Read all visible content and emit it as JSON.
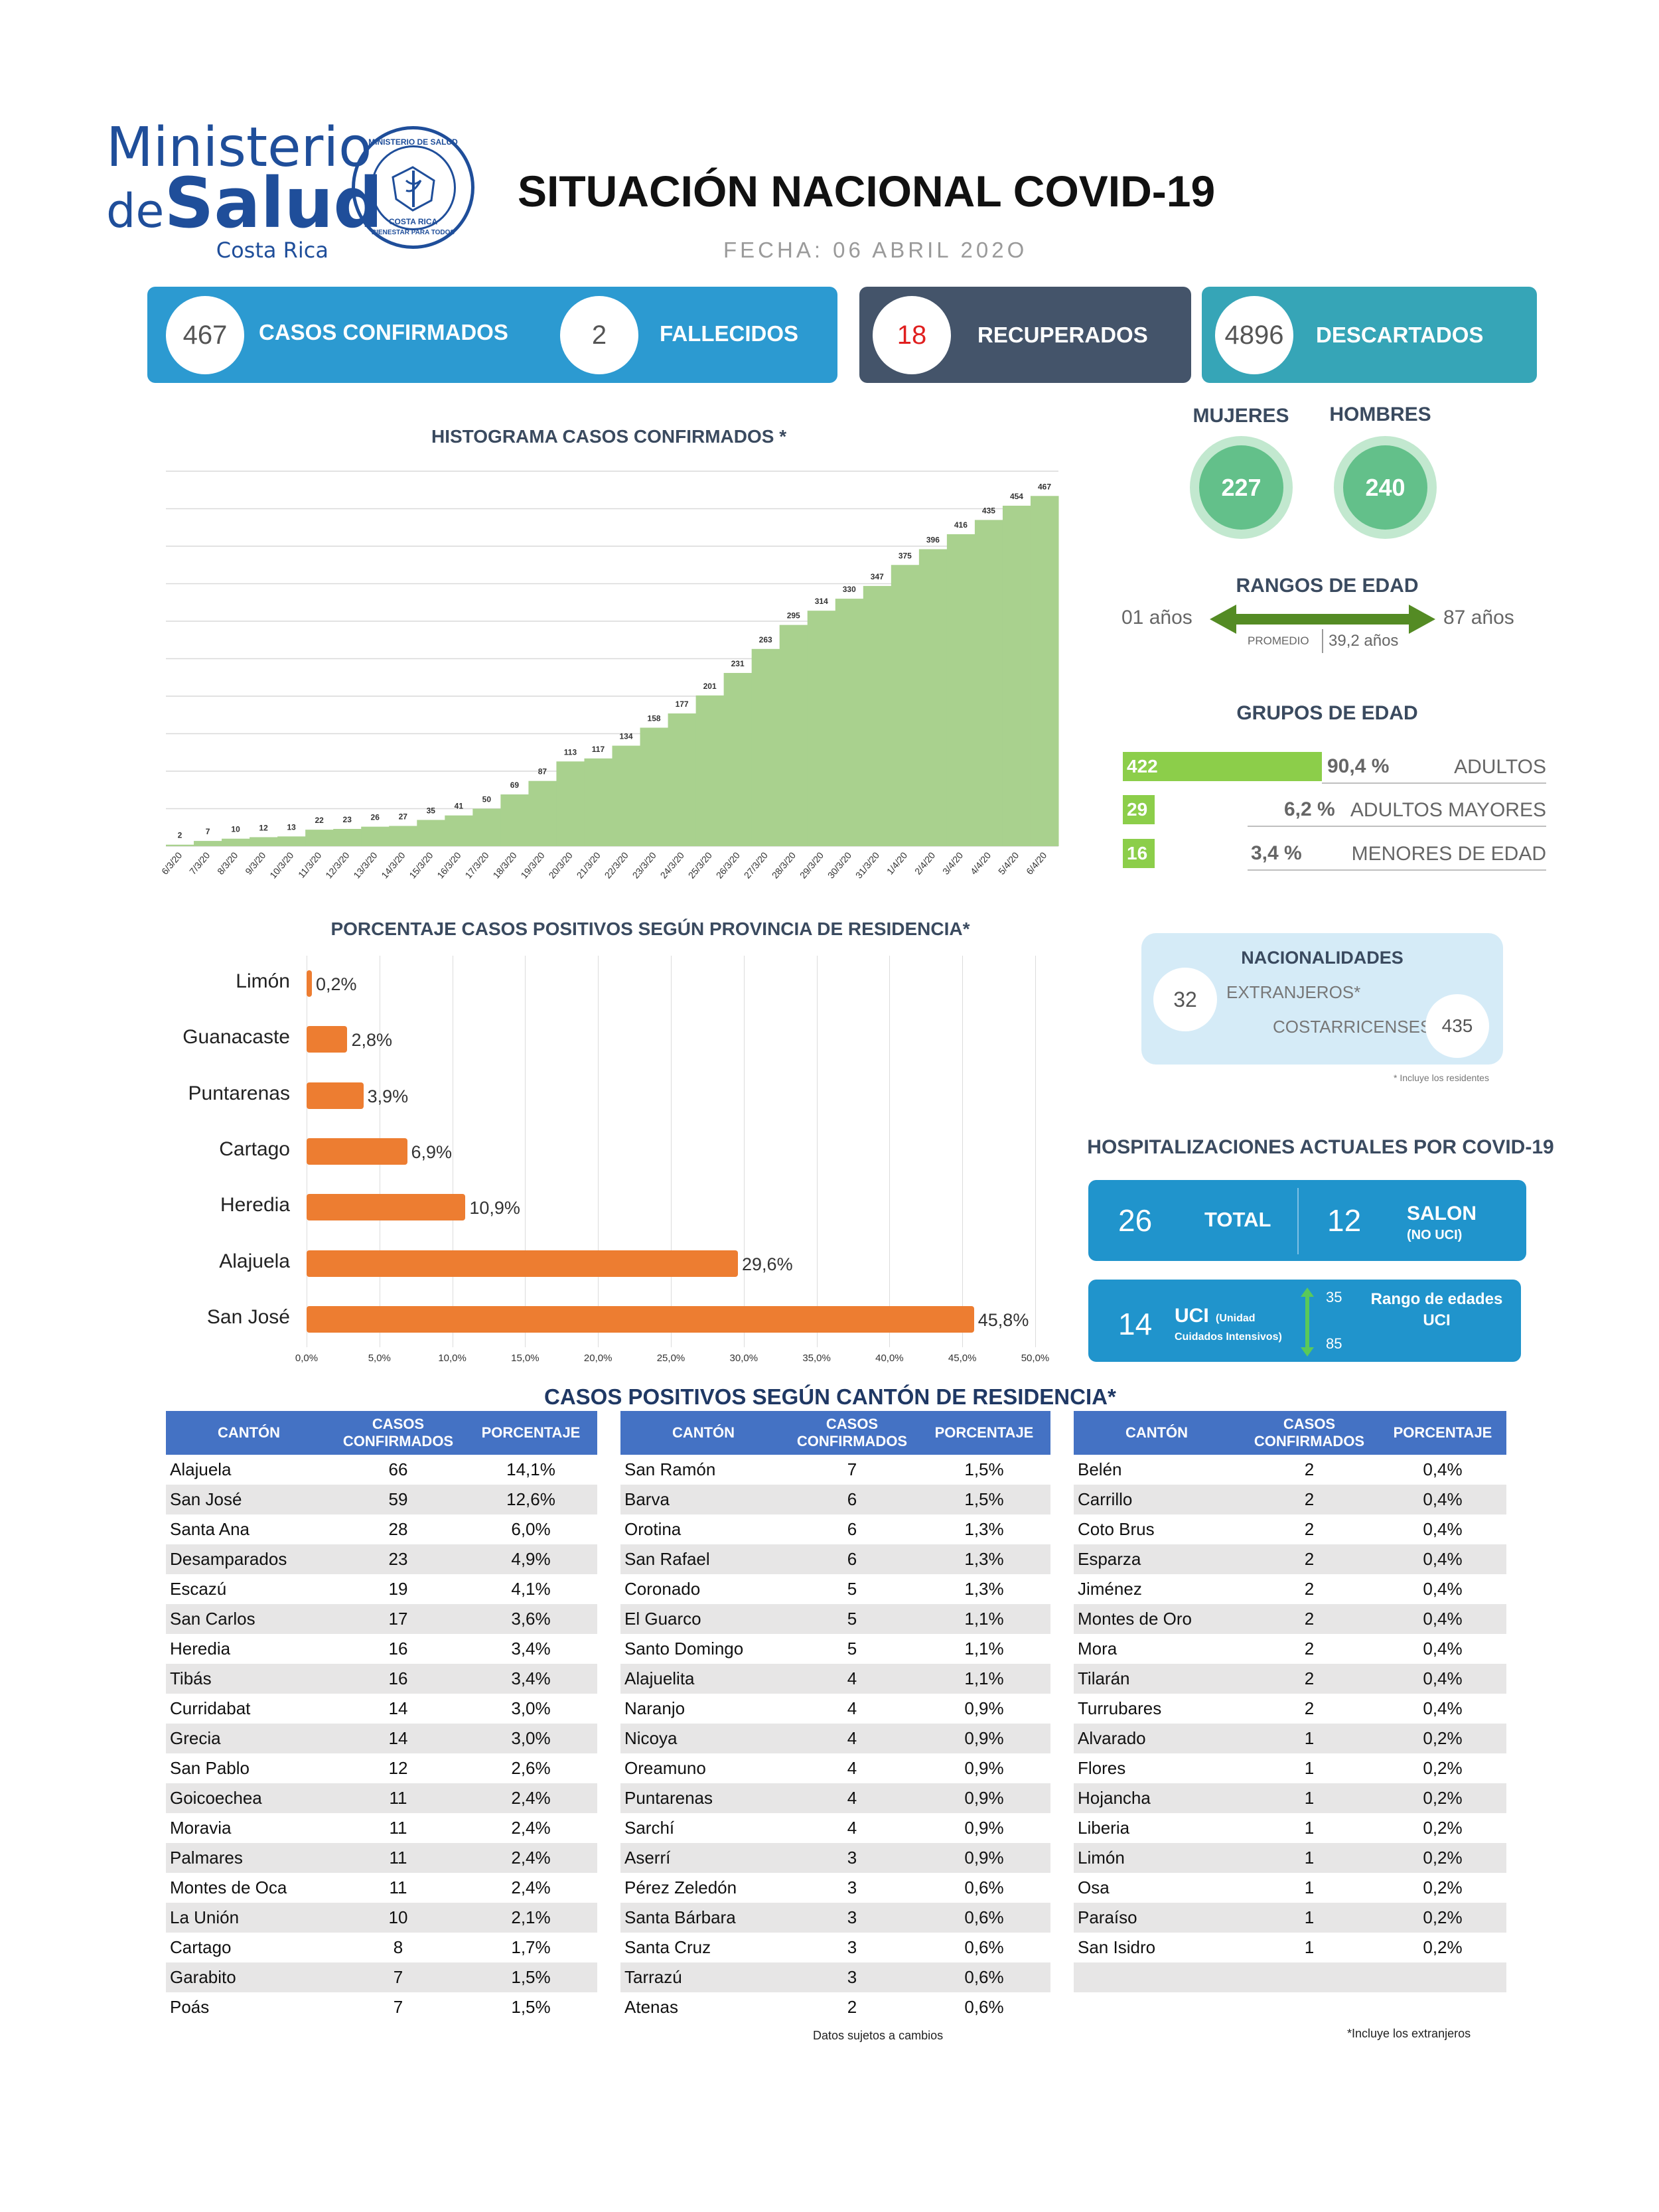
{
  "header": {
    "logo_line1": "Ministerio",
    "logo_de": "de",
    "logo_salud": "Salud",
    "logo_country": "Costa Rica",
    "seal_top": "MINISTERIO DE SALUD",
    "seal_mid": "COSTA RICA",
    "seal_bottom": "BIENESTAR PARA TODOS",
    "title": "SITUACIÓN NACIONAL COVID-19",
    "fecha": "FECHA: 06  ABRIL 202O"
  },
  "kpis": {
    "confirmados_value": "467",
    "confirmados_label": "CASOS CONFIRMADOS",
    "fallecidos_value": "2",
    "fallecidos_label": "FALLECIDOS",
    "recuperados_value": "18",
    "recuperados_label": "RECUPERADOS",
    "descartados_value": "4896",
    "descartados_label": "DESCARTADOS",
    "colors": {
      "blue": "#2c9ad1",
      "dark": "#44546a",
      "teal": "#36a5b7",
      "red": "#e01f1f"
    }
  },
  "histogram": {
    "title": "HISTOGRAMA CASOS CONFIRMADOS *"
  },
  "chart_data": [
    {
      "type": "area",
      "title": "HISTOGRAMA CASOS CONFIRMADOS *",
      "x": [
        "6/3/20",
        "7/3/20",
        "8/3/20",
        "9/3/20",
        "10/3/20",
        "11/3/20",
        "12/3/20",
        "13/3/20",
        "14/3/20",
        "15/3/20",
        "16/3/20",
        "17/3/20",
        "18/3/20",
        "19/3/20",
        "20/3/20",
        "21/3/20",
        "22/3/20",
        "23/3/20",
        "24/3/20",
        "25/3/20",
        "26/3/20",
        "27/3/20",
        "28/3/20",
        "29/3/20",
        "30/3/20",
        "31/3/20",
        "1/4/20",
        "2/4/20",
        "3/4/20",
        "4/4/20",
        "5/4/20",
        "6/4/20"
      ],
      "values": [
        2,
        7,
        10,
        12,
        13,
        22,
        23,
        26,
        27,
        35,
        41,
        50,
        69,
        87,
        113,
        117,
        134,
        158,
        177,
        201,
        231,
        263,
        295,
        314,
        330,
        347,
        375,
        396,
        416,
        435,
        454,
        467
      ],
      "ylim": [
        0,
        500
      ],
      "grid": true,
      "color": "#a9d18e"
    },
    {
      "type": "bar",
      "orientation": "horizontal",
      "title": "PORCENTAJE CASOS POSITIVOS SEGÚN PROVINCIA DE RESIDENCIA*",
      "categories": [
        "Limón",
        "Guanacaste",
        "Puntarenas",
        "Cartago",
        "Heredia",
        "Alajuela",
        "San José"
      ],
      "values": [
        0.2,
        2.8,
        3.9,
        6.9,
        10.9,
        29.6,
        45.8
      ],
      "value_labels": [
        "0,2%",
        "2,8%",
        "3,9%",
        "6,9%",
        "10,9%",
        "29,6%",
        "45,8%"
      ],
      "xticks": [
        "0,0%",
        "5,0%",
        "10,0%",
        "15,0%",
        "20,0%",
        "25,0%",
        "30,0%",
        "35,0%",
        "40,0%",
        "45,0%",
        "50,0%"
      ],
      "xlim": [
        0,
        50
      ],
      "color": "#ed7d31"
    }
  ],
  "provincias": {
    "title": "PORCENTAJE CASOS POSITIVOS SEGÚN PROVINCIA DE RESIDENCIA*"
  },
  "sexo": {
    "mujeres_label": "MUJERES",
    "mujeres_value": "227",
    "hombres_label": "HOMBRES",
    "hombres_value": "240"
  },
  "rangos": {
    "title": "RANGOS DE EDAD",
    "min": "01 años",
    "max": "87 años",
    "promedio_label": "PROMEDIO",
    "promedio_value": "39,2 años"
  },
  "grupos": {
    "title": "GRUPOS DE EDAD",
    "rows": [
      {
        "count": "422",
        "pct": "90,4 %",
        "label": "ADULTOS",
        "fraction": 0.904
      },
      {
        "count": "29",
        "pct": "6,2 %",
        "label": "ADULTOS MAYORES",
        "fraction": 0.062
      },
      {
        "count": "16",
        "pct": "3,4  %",
        "label": "MENORES DE EDAD",
        "fraction": 0.034
      }
    ]
  },
  "nacionalidades": {
    "title": "NACIONALIDADES",
    "extranjeros_value": "32",
    "extranjeros_label": "EXTRANJEROS*",
    "costarricenses_value": "435",
    "costarricenses_label": "COSTARRICENSES",
    "note": "* Incluye los residentes"
  },
  "hospital": {
    "title": "HOSPITALIZACIONES ACTUALES POR COVID-19",
    "total_value": "26",
    "total_label": "TOTAL",
    "salon_value": "12",
    "salon_label": "SALON",
    "salon_sub": "(NO UCI)",
    "uci_value": "14",
    "uci_label": "UCI",
    "uci_sub1": "(Unidad",
    "uci_sub2": "Cuidados Intensivos)",
    "range_low": "35",
    "range_high": "85",
    "range_label": "Rango de edades UCI"
  },
  "canton": {
    "title": "CASOS POSITIVOS SEGÚN CANTÓN DE RESIDENCIA*",
    "headers": {
      "canton": "CANTÓN",
      "casos1": "CASOS",
      "casos2": "CONFIRMADOS",
      "pct": "PORCENTAJE"
    },
    "col1": [
      [
        "Alajuela",
        "66",
        "14,1%"
      ],
      [
        "San José",
        "59",
        "12,6%"
      ],
      [
        "Santa Ana",
        "28",
        "6,0%"
      ],
      [
        "Desamparados",
        "23",
        "4,9%"
      ],
      [
        "Escazú",
        "19",
        "4,1%"
      ],
      [
        "San Carlos",
        "17",
        "3,6%"
      ],
      [
        "Heredia",
        "16",
        "3,4%"
      ],
      [
        "Tibás",
        "16",
        "3,4%"
      ],
      [
        "Curridabat",
        "14",
        "3,0%"
      ],
      [
        "Grecia",
        "14",
        "3,0%"
      ],
      [
        "San Pablo",
        "12",
        "2,6%"
      ],
      [
        "Goicoechea",
        "11",
        "2,4%"
      ],
      [
        "Moravia",
        "11",
        "2,4%"
      ],
      [
        "Palmares",
        "11",
        "2,4%"
      ],
      [
        "Montes de Oca",
        "11",
        "2,4%"
      ],
      [
        "La Unión",
        "10",
        "2,1%"
      ],
      [
        "Cartago",
        "8",
        "1,7%"
      ],
      [
        "Garabito",
        "7",
        "1,5%"
      ],
      [
        "Poás",
        "7",
        "1,5%"
      ]
    ],
    "col2": [
      [
        "San Ramón",
        "7",
        "1,5%"
      ],
      [
        "Barva",
        "6",
        "1,5%"
      ],
      [
        "Orotina",
        "6",
        "1,3%"
      ],
      [
        "San Rafael",
        "6",
        "1,3%"
      ],
      [
        "Coronado",
        "5",
        "1,3%"
      ],
      [
        "El Guarco",
        "5",
        "1,1%"
      ],
      [
        "Santo Domingo",
        "5",
        "1,1%"
      ],
      [
        "Alajuelita",
        "4",
        "1,1%"
      ],
      [
        "Naranjo",
        "4",
        "0,9%"
      ],
      [
        "Nicoya",
        "4",
        "0,9%"
      ],
      [
        "Oreamuno",
        "4",
        "0,9%"
      ],
      [
        "Puntarenas",
        "4",
        "0,9%"
      ],
      [
        "Sarchí",
        "4",
        "0,9%"
      ],
      [
        "Aserrí",
        "3",
        "0,9%"
      ],
      [
        "Pérez Zeledón",
        "3",
        "0,6%"
      ],
      [
        "Santa Bárbara",
        "3",
        "0,6%"
      ],
      [
        "Santa Cruz",
        "3",
        "0,6%"
      ],
      [
        "Tarrazú",
        "3",
        "0,6%"
      ],
      [
        "Atenas",
        "2",
        "0,6%"
      ]
    ],
    "col3": [
      [
        "Belén",
        "2",
        "0,4%"
      ],
      [
        "Carrillo",
        "2",
        "0,4%"
      ],
      [
        "Coto Brus",
        "2",
        "0,4%"
      ],
      [
        "Esparza",
        "2",
        "0,4%"
      ],
      [
        "Jiménez",
        "2",
        "0,4%"
      ],
      [
        "Montes de Oro",
        "2",
        "0,4%"
      ],
      [
        "Mora",
        "2",
        "0,4%"
      ],
      [
        "Tilarán",
        "2",
        "0,4%"
      ],
      [
        "Turrubares",
        "2",
        "0,4%"
      ],
      [
        "Alvarado",
        "1",
        "0,2%"
      ],
      [
        "Flores",
        "1",
        "0,2%"
      ],
      [
        "Hojancha",
        "1",
        "0,2%"
      ],
      [
        "Liberia",
        "1",
        "0,2%"
      ],
      [
        "Limón",
        "1",
        "0,2%"
      ],
      [
        "Osa",
        "1",
        "0,2%"
      ],
      [
        "Paraíso",
        "1",
        "0,2%"
      ],
      [
        "San Isidro",
        "1",
        "0,2%"
      ],
      [
        "",
        "",
        " "
      ],
      [
        "",
        "",
        " "
      ]
    ],
    "note_left": "Datos sujetos a cambios",
    "note_right": "*Incluye los extranjeros"
  }
}
